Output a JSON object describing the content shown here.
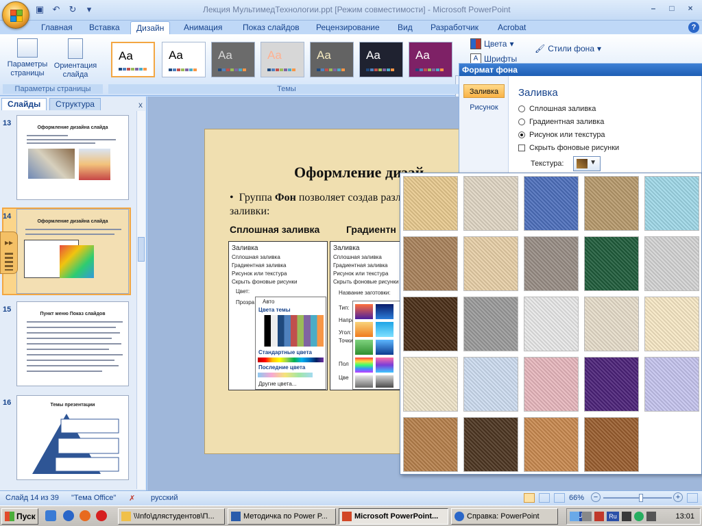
{
  "window": {
    "title": "Лекция МультимедТехнологии.ppt [Режим совместимости] - Microsoft PowerPoint",
    "controls": [
      "–",
      "□",
      "×"
    ]
  },
  "quick_access": {
    "save": "save-icon",
    "undo": "undo-icon",
    "redo": "redo-icon",
    "customize": "▾"
  },
  "ribbon": {
    "tabs": [
      "Главная",
      "Вставка",
      "Дизайн",
      "Анимация",
      "Показ слайдов",
      "Рецензирование",
      "Вид",
      "Разработчик",
      "Acrobat"
    ],
    "active_tab": "Дизайн",
    "page_setup": {
      "params_label": "Параметры страницы",
      "orientation_label": "Ориентация слайда",
      "group_label": "Параметры страницы"
    },
    "themes": {
      "group_label": "Темы",
      "tiles": [
        {
          "text": "Aa",
          "bg": "#ffffff",
          "fg": "#000000"
        },
        {
          "text": "Aa",
          "bg": "#ffffff",
          "fg": "#000000"
        },
        {
          "text": "Aa",
          "bg": "#6b6b6b",
          "fg": "#d8d8d8"
        },
        {
          "text": "Aa",
          "bg": "#d7d7d7",
          "fg": "#ffb090"
        },
        {
          "text": "Aa",
          "bg": "#636363",
          "fg": "#f4e9c0"
        },
        {
          "text": "Aa",
          "bg": "#1f2230",
          "fg": "#ffffff"
        },
        {
          "text": "Aa",
          "bg": "#7e2166",
          "fg": "#ffffff"
        }
      ]
    },
    "colors_label": "Цвета",
    "fonts_label": "Шрифты",
    "bg_styles_label": "Стили фона"
  },
  "left_panel": {
    "tabs": [
      "Слайды",
      "Структура"
    ],
    "close": "x",
    "slides": [
      {
        "num": "13",
        "title": "Оформление дизайна слайда"
      },
      {
        "num": "14",
        "title": "Оформление дизайна слайда"
      },
      {
        "num": "15",
        "title": "Пункт меню Показ слайдов"
      },
      {
        "num": "16",
        "title": "Темы презентации"
      }
    ]
  },
  "slide": {
    "title": "Оформление дизай",
    "bullet_prefix": "Группа ",
    "bullet_bold": "Фон",
    "bullet_rest": " позволяет создав различные виды заливки:",
    "sub1": "Сплошная заливка",
    "sub2": "Градиентн",
    "shot1": {
      "head": "Заливка",
      "options": [
        "Сплошная заливка",
        "Градиентная заливка",
        "Рисунок или текстура",
        "Скрыть фоновые рисунки"
      ],
      "color_label": "Цвет:",
      "transp_label": "Прозра",
      "auto": "Авто",
      "theme_colors": "Цвета темы",
      "std_colors": "Стандартные цвета",
      "recent_colors": "Последние цвета",
      "more_colors": "Другие цвета..."
    },
    "shot2": {
      "head": "Заливка",
      "options": [
        "Сплошная заливка",
        "Градиентная заливка",
        "Рисунок или текстура",
        "Скрыть фоновые рисунки"
      ],
      "preset": "Название заготовки:",
      "rows": [
        "Тип:",
        "Напра",
        "Угол:",
        "Точки",
        "Пол",
        "Цве"
      ]
    }
  },
  "format_dialog": {
    "title": "Формат фона",
    "side_items": [
      "Заливка",
      "Рисунок"
    ],
    "fill_head": "Заливка",
    "options": [
      {
        "label": "Сплошная заливка",
        "type": "radio",
        "checked": false
      },
      {
        "label": "Градиентная заливка",
        "type": "radio",
        "checked": false
      },
      {
        "label": "Рисунок или текстура",
        "type": "radio",
        "checked": true
      },
      {
        "label": "Скрыть фоновые рисунки",
        "type": "check",
        "checked": false
      }
    ],
    "texture_label": "Текстура:"
  },
  "texture_popup": {
    "textures": [
      {
        "name": "papyrus",
        "color": "#e8c98e"
      },
      {
        "name": "canvas",
        "color": "#e0d6c4"
      },
      {
        "name": "denim",
        "color": "#4d6fbc"
      },
      {
        "name": "woven-mat",
        "color": "#b79a6c"
      },
      {
        "name": "water-droplets",
        "color": "#9fd8e8"
      },
      {
        "name": "paper-bag",
        "color": "#a9825b"
      },
      {
        "name": "fish-fossil",
        "color": "#e7cfa7"
      },
      {
        "name": "sand",
        "color": "#988d85"
      },
      {
        "name": "green-marble",
        "color": "#1f5c3b"
      },
      {
        "name": "white-marble",
        "color": "#d4d4d4"
      },
      {
        "name": "brown-marble",
        "color": "#4a2e17"
      },
      {
        "name": "granite",
        "color": "#9b9b9b"
      },
      {
        "name": "newsprint",
        "color": "#e8e8e8"
      },
      {
        "name": "recycled-paper",
        "color": "#e6ddca"
      },
      {
        "name": "parchment",
        "color": "#f7e8c5"
      },
      {
        "name": "stationery",
        "color": "#efe4c8"
      },
      {
        "name": "blue-tissue-paper",
        "color": "#cddcf0"
      },
      {
        "name": "pink-tissue-paper",
        "color": "#e7b7bd"
      },
      {
        "name": "purple-mesh",
        "color": "#4c2279"
      },
      {
        "name": "bouquet",
        "color": "#c5c4ee"
      },
      {
        "name": "cork",
        "color": "#b6804b"
      },
      {
        "name": "walnut",
        "color": "#4d3521"
      },
      {
        "name": "oak",
        "color": "#c8894f"
      },
      {
        "name": "medium-wood",
        "color": "#9a5e2f"
      }
    ]
  },
  "status": {
    "slide_info": "Слайд 14 из 39",
    "theme": "\"Тема Office\"",
    "language": "русский",
    "zoom": "66%",
    "zoom_fraction": 0.55
  },
  "taskbar": {
    "start": "Пуск",
    "items": [
      {
        "label": "\\\\Info\\длястудентов\\П...",
        "active": false
      },
      {
        "label": "Методичка по Power P...",
        "active": false
      },
      {
        "label": "Microsoft PowerPoint...",
        "active": true
      },
      {
        "label": "Справка: PowerPoint",
        "active": false
      }
    ],
    "lang": "RU",
    "tray_lang": "Ru",
    "clock": "13:01"
  },
  "colors": {
    "accent": "#15428b",
    "selection": "#f3a641",
    "dialog_title": "#1f5fb5"
  }
}
